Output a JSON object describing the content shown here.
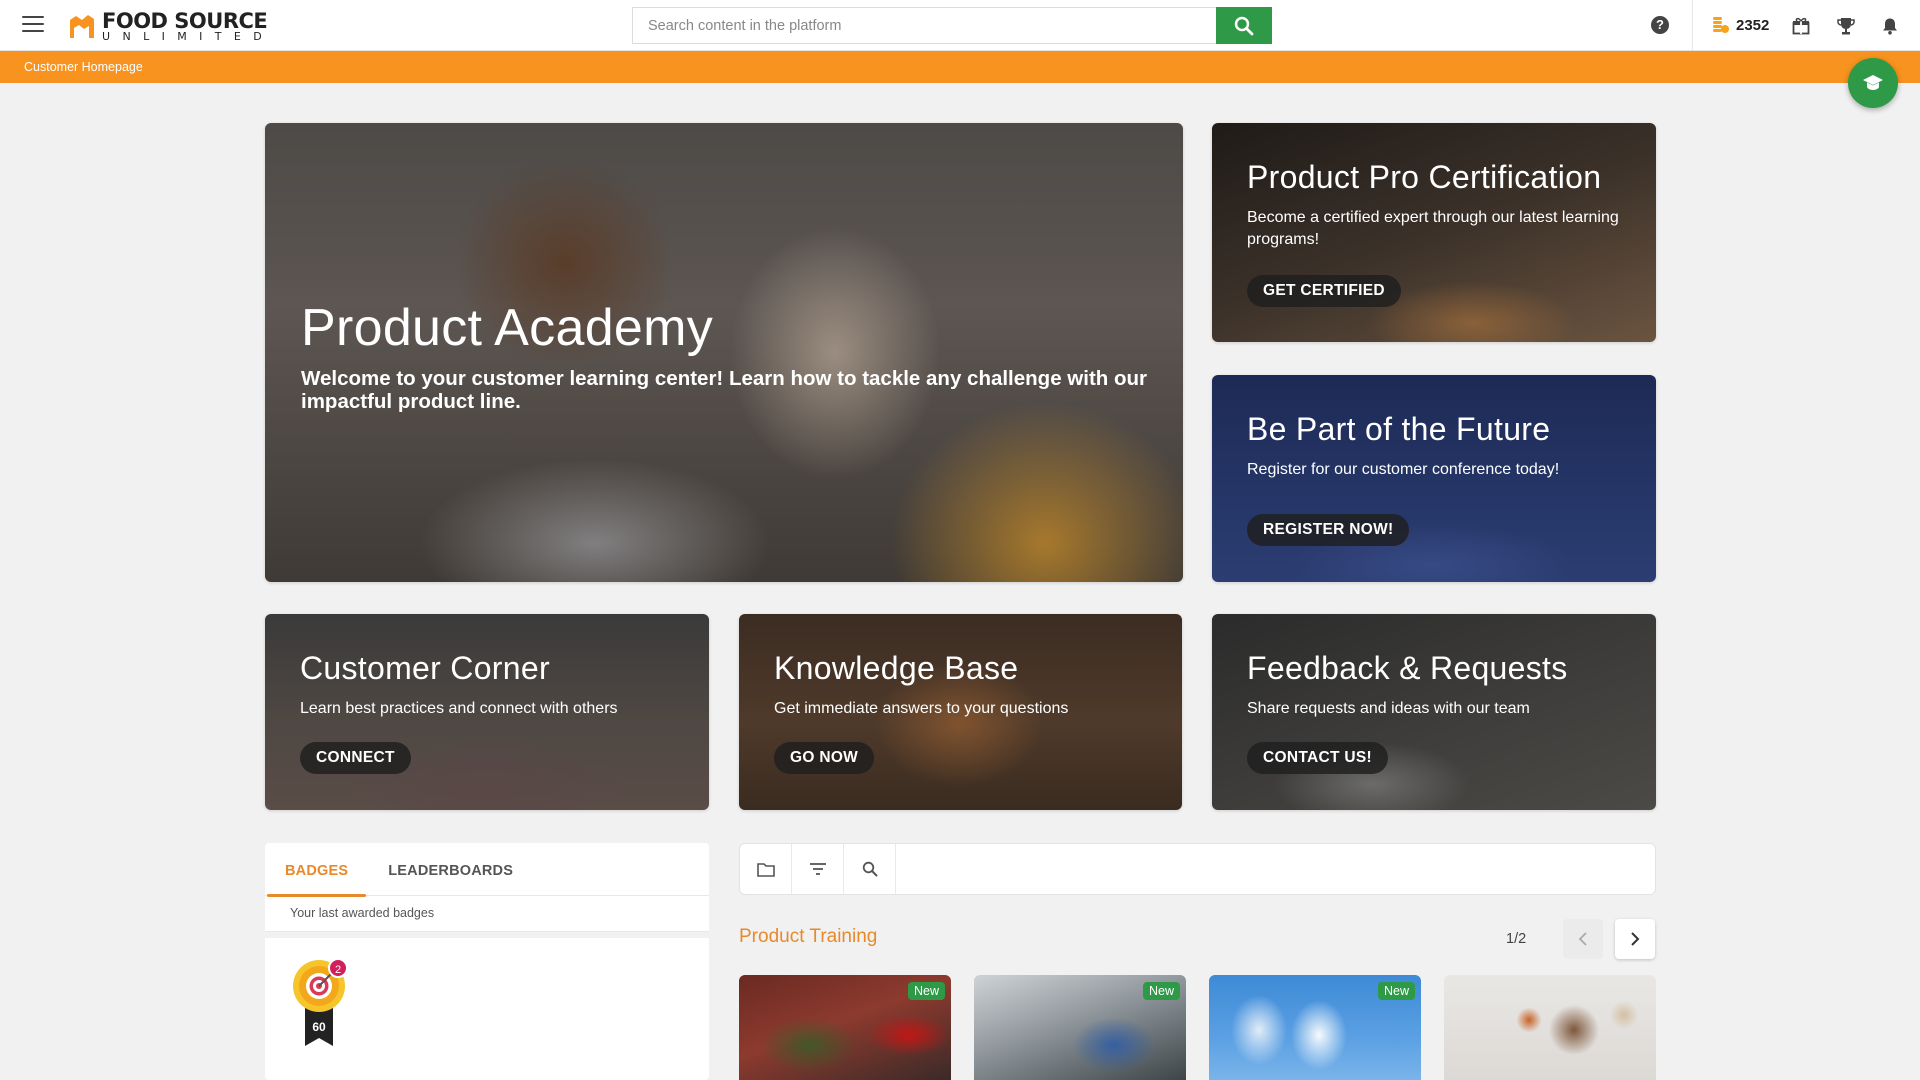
{
  "brand": {
    "name_main": "FOOD SOURCE",
    "name_sub": "UNLIMITED"
  },
  "search": {
    "placeholder": "Search content in the platform"
  },
  "header": {
    "help_icon": "question-circle-icon",
    "coins_value": "2352"
  },
  "breadcrumb": {
    "label": "Customer Homepage"
  },
  "tiles": {
    "hero": {
      "title": "Product Academy",
      "subtitle": "Welcome to your customer learning center! Learn how to tackle any challenge with our impactful product line."
    },
    "certification": {
      "title": "Product Pro Certification",
      "subtitle": "Become a certified expert through our latest learning programs!",
      "button": "GET CERTIFIED"
    },
    "future": {
      "title": "Be Part of the Future",
      "subtitle": "Register for our customer conference today!",
      "button": "REGISTER NOW!"
    },
    "corner": {
      "title": "Customer Corner",
      "subtitle": "Learn best practices and connect with others",
      "button": "CONNECT"
    },
    "knowledge": {
      "title": "Knowledge Base",
      "subtitle": "Get immediate answers to your questions",
      "button": "GO NOW"
    },
    "feedback": {
      "title": "Feedback & Requests",
      "subtitle": "Share requests and ideas with our team",
      "button": "CONTACT US!"
    }
  },
  "badges": {
    "tabs": [
      "BADGES",
      "LEADERBOARDS"
    ],
    "hint": "Your last awarded badges",
    "badge_count": "2",
    "badge_points": "60"
  },
  "catalog": {
    "section_title": "Product Training",
    "pager": "1/2",
    "cards": [
      {
        "tag": "New"
      },
      {
        "tag": "New"
      },
      {
        "tag": "New"
      },
      {
        "tag": ""
      }
    ]
  },
  "colors": {
    "accent_orange": "#f7931e",
    "accent_green": "#2e9a47",
    "badge_red": "#d01f5c"
  }
}
